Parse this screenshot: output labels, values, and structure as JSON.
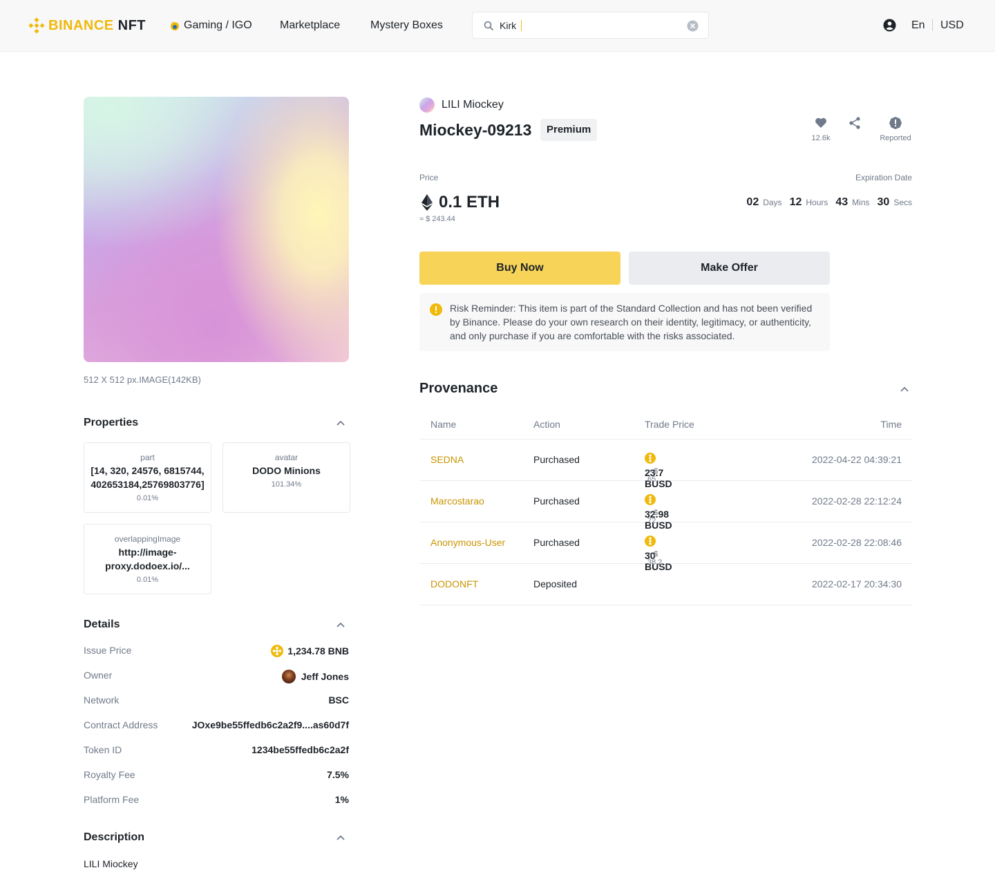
{
  "header": {
    "logo_brand": "BINANCE",
    "logo_suffix": "NFT",
    "nav": [
      {
        "label": "Gaming / IGO"
      },
      {
        "label": "Marketplace"
      },
      {
        "label": "Mystery Boxes"
      }
    ],
    "search_value": "Kirk",
    "lang": "En",
    "currency": "USD",
    "icons": {
      "search": "search-icon",
      "clear": "clear-icon",
      "user": "user-icon",
      "gaming": "fire-icon"
    }
  },
  "colors": {
    "accent": "#f0b90b",
    "buy_button": "#f7d358",
    "link": "#c99400"
  },
  "left": {
    "image_meta": "512 X 512 px.IMAGE(142KB)",
    "properties": {
      "title": "Properties",
      "cards": [
        {
          "label": "part",
          "value": "[14, 320, 24576, 6815744, 402653184,25769803776]",
          "pct": "0.01%"
        },
        {
          "label": "avatar",
          "value": "DODO Minions",
          "pct": "101.34%"
        },
        {
          "label": "overlappingImage",
          "value": "http://image-proxy.dodoex.io/...",
          "pct": "0.01%"
        }
      ]
    },
    "details": {
      "title": "Details",
      "rows": [
        {
          "label": "Issue Price",
          "value": "1,234.78 BNB"
        },
        {
          "label": "Owner",
          "value": "Jeff Jones"
        },
        {
          "label": "Network",
          "value": "BSC"
        },
        {
          "label": "Contract Address",
          "value": "JOxe9be55ffedb6c2a2f9....as60d7f"
        },
        {
          "label": "Token ID",
          "value": "1234be55ffedb6c2a2f"
        },
        {
          "label": "Royalty Fee",
          "value": "7.5%"
        },
        {
          "label": "Platform Fee",
          "value": "1%"
        }
      ]
    },
    "description": {
      "title": "Description",
      "text": "LILI Miockey"
    }
  },
  "right": {
    "collection": "LILI Miockey",
    "title": "Miockey-09213",
    "badge": "Premium",
    "actions": {
      "likes": "12.6k",
      "report": "Reported"
    },
    "price_label": "Price",
    "price": "0.1 ETH",
    "price_usd": "≈ $ 243.44",
    "expiration_label": "Expiration Date",
    "countdown": [
      {
        "num": "02",
        "unit": "Days"
      },
      {
        "num": "12",
        "unit": "Hours"
      },
      {
        "num": "43",
        "unit": "Mins"
      },
      {
        "num": "30",
        "unit": "Secs"
      }
    ],
    "buy_label": "Buy Now",
    "offer_label": "Make Offer",
    "risk_text": "Risk Reminder: This item is part of the Standard Collection and has not been verified by Binance. Please do your own research on their identity, legitimacy, or authenticity, and only purchase if you are comfortable with the risks associated.",
    "provenance": {
      "title": "Provenance",
      "columns": [
        "Name",
        "Action",
        "Trade Price",
        "Time"
      ],
      "rows": [
        {
          "name": "SEDNA",
          "action": "Purchased",
          "price": "23.7 BUSD",
          "usd": "≈ $ 65",
          "time": "2022-04-22 04:39:21"
        },
        {
          "name": "Marcostarao",
          "action": "Purchased",
          "price": "32.98 BUSD",
          "usd": "≈ $ 72",
          "time": "2022-02-28 22:12:24"
        },
        {
          "name": "Anonymous-User",
          "action": "Purchased",
          "price": "30 BUSD",
          "usd": "≈ $ 38.2",
          "time": "2022-02-28 22:08:46"
        },
        {
          "name": "DODONFT",
          "action": "Deposited",
          "price": "",
          "usd": "",
          "time": "2022-02-17 20:34:30"
        }
      ]
    }
  }
}
